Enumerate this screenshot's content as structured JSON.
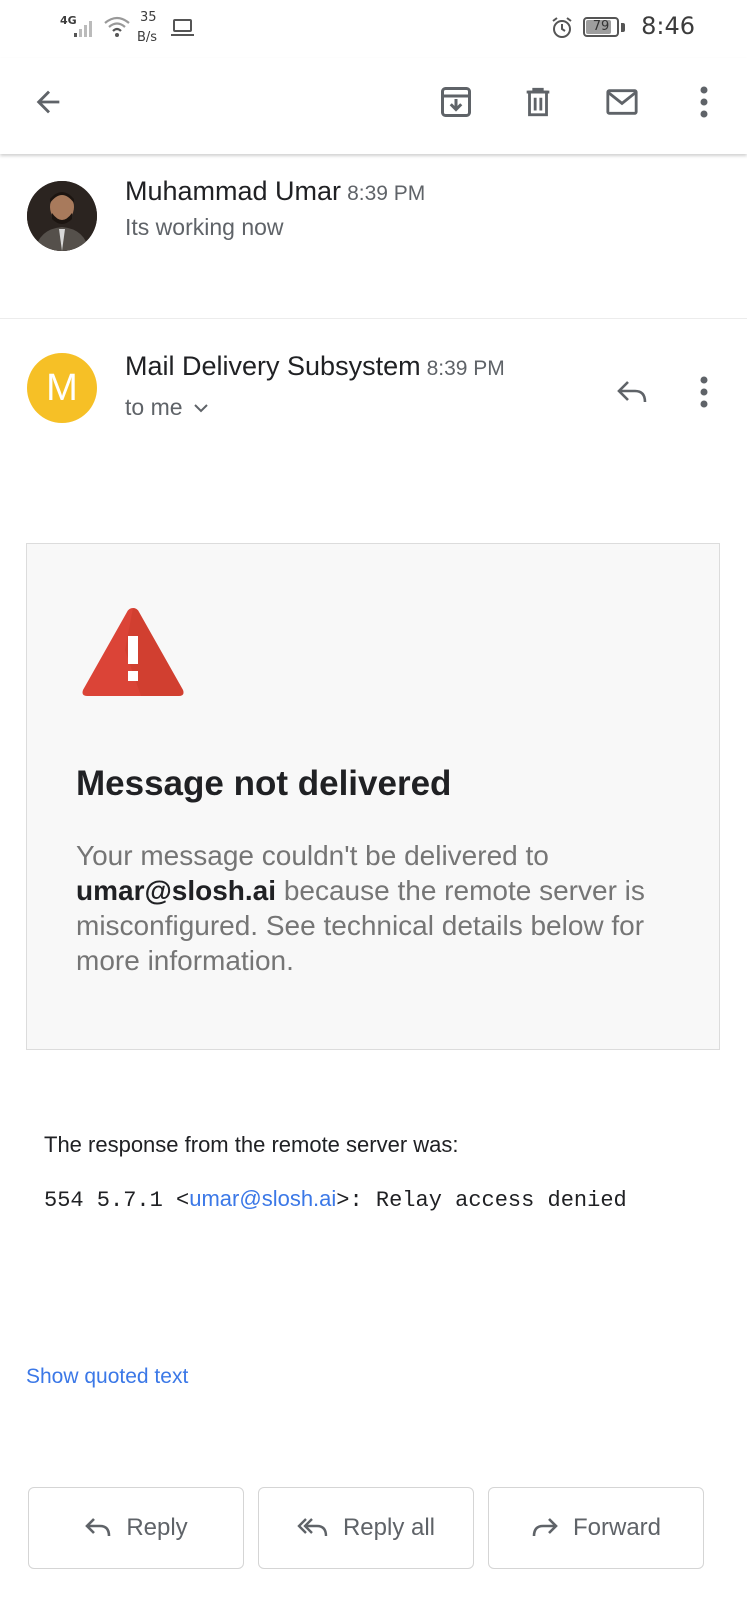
{
  "status_bar": {
    "network": "4G",
    "speed_value": "35",
    "speed_unit": "B/s",
    "battery": "79",
    "battery_fraction": 0.79,
    "time": "8:46"
  },
  "toolbar": {
    "back_icon": "arrow-back-icon",
    "archive_icon": "archive-icon",
    "delete_icon": "trash-icon",
    "mark_unread_icon": "mail-icon",
    "more_icon": "more-vert-icon"
  },
  "thread": {
    "collapsed_message": {
      "sender": "Muhammad Umar",
      "time": "8:39 PM",
      "snippet": "Its working now"
    },
    "open_message": {
      "avatar_letter": "M",
      "avatar_color": "#f6c026",
      "sender": "Mail Delivery Subsystem",
      "time": "8:39 PM",
      "recipient": "to me",
      "body": {
        "card_title": "Message not delivered",
        "card_text_before": "Your message couldn't be delivered to ",
        "card_email": "umar@slosh.ai",
        "card_text_after": " because the remote server is misconfigured. See technical details below for more information.",
        "response_label": "The response from the remote server was:",
        "response_code_prefix": "554 5.7.1 <",
        "response_email": "umar@slosh.ai",
        "response_code_suffix": ">: Relay access denied",
        "show_quoted_text": "Show quoted text"
      }
    }
  },
  "actions": {
    "reply": "Reply",
    "reply_all": "Reply all",
    "forward": "Forward"
  },
  "colors": {
    "link": "#3b78e7",
    "warning_red": "#db4437",
    "card_bg": "#f8f8f8"
  }
}
